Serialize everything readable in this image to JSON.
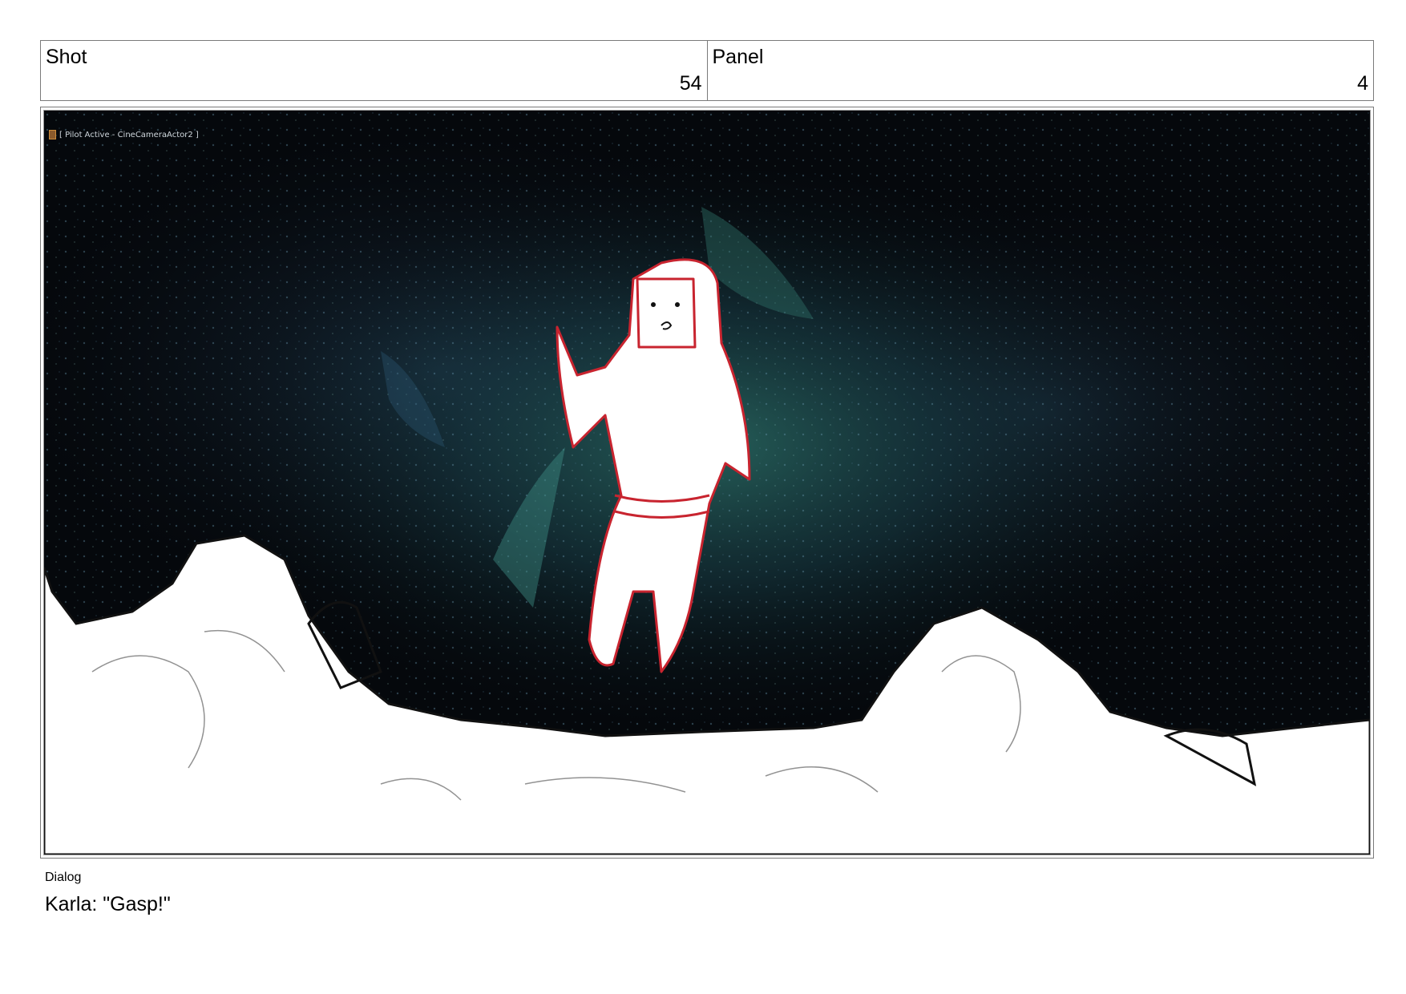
{
  "header": {
    "shot": {
      "label": "Shot",
      "value": "54"
    },
    "panel": {
      "label": "Panel",
      "value": "4"
    }
  },
  "frame": {
    "overlay": "[ Pilot Active - CineCameraActor2 ]",
    "icons": [
      "camera-icon"
    ],
    "colors": {
      "cave_dark": "#05080c",
      "cave_teal": "#1f5a55",
      "cave_blue": "#1d3448",
      "sketch_red": "#c8242f",
      "rock_white": "#ffffff"
    }
  },
  "dialog": {
    "label": "Dialog",
    "text": "Karla: \"Gasp!\""
  }
}
